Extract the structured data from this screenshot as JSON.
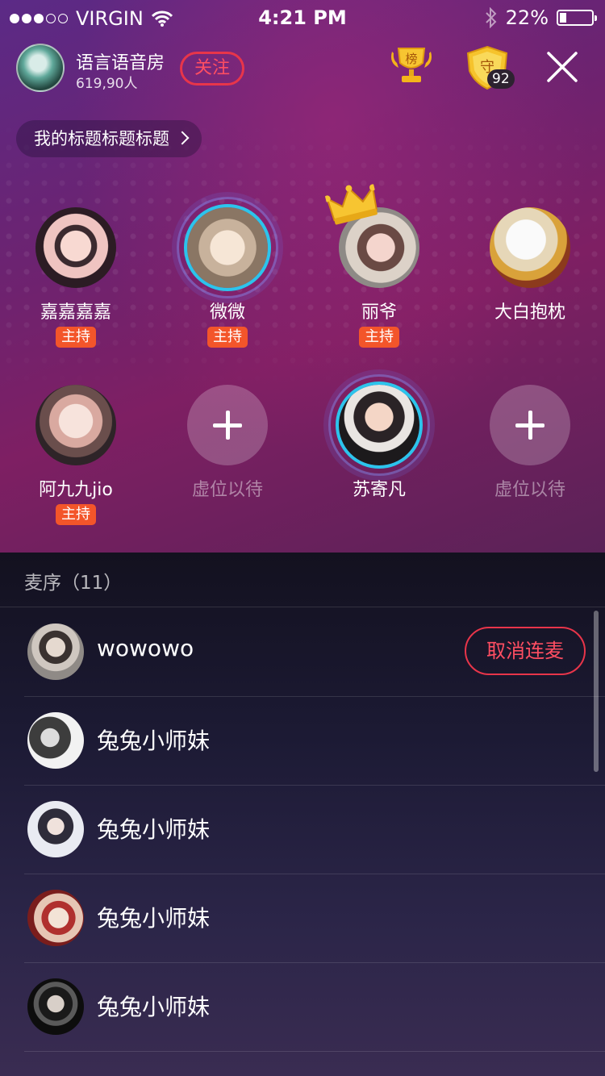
{
  "status_bar": {
    "carrier": "VIRGIN",
    "time": "4:21 PM",
    "battery_text": "22%",
    "battery_level": 0.22
  },
  "room": {
    "name": "语言语音房",
    "count": "619,90人",
    "follow_label": "关注",
    "rank_icon_label": "榜",
    "guard_icon_label": "守",
    "guard_count": "92",
    "title_pill": "我的标题标题标题"
  },
  "seats": [
    {
      "name": "嘉嘉嘉嘉",
      "badge": "主持"
    },
    {
      "name": "微微",
      "badge": "主持"
    },
    {
      "name": "丽爷",
      "badge": "主持"
    },
    {
      "name": "大白抱枕",
      "badge": ""
    },
    {
      "name": "阿九九jio",
      "badge": "主持"
    },
    {
      "name": "虚位以待",
      "badge": ""
    },
    {
      "name": "苏寄凡",
      "badge": ""
    },
    {
      "name": "虚位以待",
      "badge": ""
    }
  ],
  "queue": {
    "header": "麦序（11）",
    "cancel_label": "取消连麦",
    "items": [
      {
        "name": "wowowo"
      },
      {
        "name": "兔兔小师妹"
      },
      {
        "name": "兔兔小师妹"
      },
      {
        "name": "兔兔小师妹"
      },
      {
        "name": "兔兔小师妹"
      }
    ]
  },
  "colors": {
    "accent_red": "#e8354a",
    "badge_orange": "#f3552a",
    "speaking_ring": "#2cc4ec"
  }
}
